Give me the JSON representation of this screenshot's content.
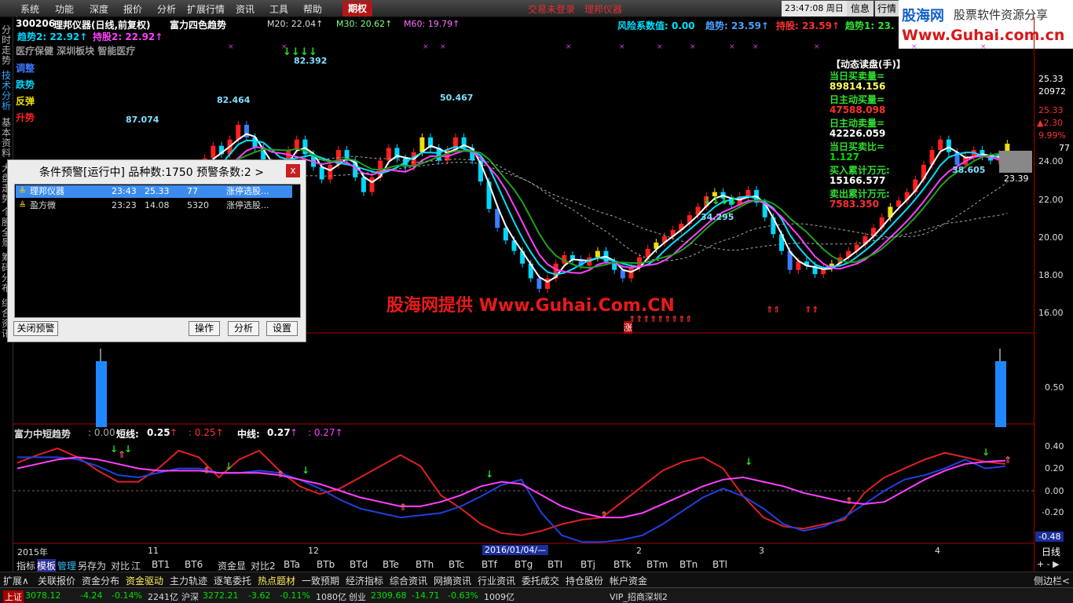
{
  "menu": {
    "items": [
      "系统",
      "功能",
      "深度",
      "报价",
      "分析",
      "扩展行情",
      "资讯",
      "工具",
      "帮助"
    ],
    "active": "期权",
    "status_red": "交易未登录　理邦仪器",
    "time": "23:47:08",
    "weekday": "周日",
    "btn_info": "信息",
    "btn_quote": "行情"
  },
  "logo": {
    "brand": "股海网",
    "slogan": "股票软件资源分享",
    "url": "Www.Guhai.com.cn"
  },
  "sidebar": {
    "tabs": [
      "分时走势",
      "技术分析",
      "基本资料",
      "大盘走势",
      "个股全景",
      "筹码分布",
      "综合资讯"
    ]
  },
  "header": {
    "code": "300206",
    "name": "理邦仪器(日线,前复权)",
    "indicator": "富力四色趋势",
    "ma20": "M20: 22.04↑",
    "ma30": "M30: 20.62↑",
    "ma60": "M60: 19.79↑",
    "risk": "风险系数值: 0.00",
    "trend_r1": "趋势: 23.59↑",
    "trend_r2": "持股: 23.59↑",
    "trend_r3": "趋势1: 23.",
    "trend2": "趋势2: 22.92↑",
    "hold2": "持股2: 22.92↑",
    "sectors": "医疗保健 深圳板块 智能医疗"
  },
  "legend": {
    "items": [
      "调整",
      "跌势",
      "反弹",
      "升势"
    ],
    "colors": [
      "#3c7cff",
      "#00d8ff",
      "#f0e000",
      "#ff2020"
    ]
  },
  "labels": {
    "p1": "87.074",
    "p2": "82.464",
    "p3": "82.392",
    "p4": "50.467",
    "p5": "34.295",
    "p6": "38.605",
    "p7": "23.39",
    "zhang": "涨"
  },
  "watermark": "股海网提供 Www.Guhai.Com.CN",
  "panel": {
    "title": "【动态读盘(手)】",
    "rows": [
      {
        "label": "当日买卖量=",
        "value": "89814.156",
        "color": "#ffff60"
      },
      {
        "label": "日主动买量=",
        "value": "47588.098",
        "color": "#ff3030"
      },
      {
        "label": "日主动卖量=",
        "value": "42226.059",
        "color": "#ffffff"
      },
      {
        "label": "当日买卖比=",
        "value": "1.127",
        "color": "#00e000"
      },
      {
        "label": "买入累计万元:",
        "value": "15166.577",
        "color": "#ffffff"
      },
      {
        "label": "卖出累计万元:",
        "value": "7583.350",
        "color": "#ff3030"
      }
    ]
  },
  "axis": {
    "price": [
      "25.33",
      "20972",
      "25.33",
      "▲2.30",
      "9.99%",
      "77",
      "24.00",
      "22.00",
      "20.00",
      "18.00",
      "16.00"
    ],
    "vol": "0.50",
    "osc": [
      "0.40",
      "0.20",
      "0.00",
      "-0.20",
      "-0.48"
    ],
    "period": "日线",
    "pm": "+  -  ▶"
  },
  "osc_header": {
    "name": "富力中短趋势",
    "v0": ": 0.00",
    "short": "短线:",
    "s1": "0.25",
    "s1a": "↑",
    "s2": ": 0.25↑",
    "mid": "中线:",
    "m1": "0.27",
    "m1a": "↑",
    "m2": ": 0.27↑"
  },
  "date_axis": [
    "2015年",
    "11",
    "12",
    "2016/01/04/—",
    "2",
    "3",
    "4"
  ],
  "popup": {
    "title": "条件预警[运行中] 品种数:1750 预警条数:2  >",
    "close": "x",
    "rows": [
      {
        "name": "理邦仪器",
        "time": "23:43",
        "price": "25.33",
        "vol": "77",
        "type": "涨停选股..."
      },
      {
        "name": "盈方微",
        "time": "23:23",
        "price": "14.08",
        "vol": "5320",
        "type": "涨停选股..."
      }
    ],
    "btn_close": "关闭预警",
    "btn_op": "操作",
    "btn_an": "分析",
    "btn_set": "设置"
  },
  "bottom_tabs": [
    "指标",
    "模板",
    "管理",
    "另存为",
    "对比",
    "江",
    "BT1",
    "BT6",
    "资金显",
    "对比2",
    "BTa",
    "BTb",
    "BTd",
    "BTe",
    "BTh",
    "BTc",
    "BTf",
    "BTg",
    "BTI",
    "BTj",
    "BTk",
    "BTm",
    "BTn",
    "BTl"
  ],
  "bottom_right": "+  -",
  "func_tabs": [
    "扩展∧",
    "关联报价",
    "资金分布",
    "资金驱动",
    "主力轨迹",
    "逐笔委托",
    "热点题材",
    "一致预期",
    "经济指标",
    "综合资讯",
    "网摘资讯",
    "行业资讯",
    "委托成交",
    "持仓股份",
    "帐户资金"
  ],
  "func_right": "侧边栏<",
  "status": {
    "sh": "上证",
    "sh_v": "3078.12",
    "sh_c": "-4.24",
    "sh_p": "-0.14%",
    "sh_a": "2241亿",
    "sz": "沪深",
    "sz_v": "3272.21",
    "sz_c": "-3.62",
    "sz_p": "-0.11%",
    "sz_a": "1080亿",
    "cy": "创业",
    "cy_v": "2309.68",
    "cy_c": "-14.71",
    "cy_p": "-0.63%",
    "cy_a": "1009亿",
    "vip": "VIP_招商深圳2"
  },
  "chart_data": {
    "type": "candlestick",
    "title": "理邦仪器(日线,前复权)",
    "ylim": [
      15.2,
      26.4
    ],
    "closes": [
      19.6,
      20.4,
      21.0,
      20.4,
      20.8,
      21.6,
      20.9,
      21.4,
      22.1,
      21.6,
      21.2,
      21.9,
      22.6,
      23.2,
      22.8,
      23.5,
      24.2,
      23.6,
      23.1,
      22.4,
      21.8,
      22.4,
      23.0,
      23.5,
      22.8,
      22.2,
      21.6,
      22.3,
      23.0,
      22.5,
      21.7,
      21.0,
      21.7,
      22.5,
      23.1,
      22.6,
      22.2,
      22.9,
      23.6,
      23.1,
      22.5,
      23.0,
      23.6,
      23.1,
      22.5,
      21.5,
      20.2,
      19.3,
      18.7,
      18.2,
      17.6,
      16.9,
      16.4,
      16.9,
      17.6,
      18.0,
      17.8,
      17.5,
      17.9,
      18.2,
      17.7,
      17.3,
      16.9,
      17.4,
      17.9,
      18.3,
      18.6,
      18.9,
      19.2,
      19.5,
      19.9,
      20.3,
      20.8,
      21.0,
      20.7,
      20.4,
      20.8,
      21.1,
      20.5,
      19.8,
      19.0,
      18.2,
      17.3,
      17.7,
      17.5,
      17.1,
      17.4,
      17.6,
      17.9,
      18.2,
      18.5,
      18.9,
      19.3,
      19.8,
      20.3,
      20.6,
      21.0,
      21.6,
      22.3,
      23.0,
      23.5,
      22.9,
      22.3,
      22.7,
      23.0,
      22.7,
      22.5,
      22.8,
      23.3
    ]
  },
  "osc_data": {
    "type": "line",
    "ylim": [
      -0.5,
      0.5
    ],
    "red": [
      0.25,
      0.32,
      0.38,
      0.3,
      0.18,
      0.08,
      0.08,
      0.2,
      0.36,
      0.3,
      0.12,
      0.28,
      0.36,
      0.18,
      0.04,
      -0.03,
      0.02,
      0.12,
      0.22,
      0.32,
      0.22,
      -0.04,
      -0.16,
      -0.3,
      -0.38,
      -0.4,
      -0.36,
      -0.3,
      -0.26,
      -0.24,
      -0.1,
      0.04,
      0.18,
      0.26,
      0.3,
      0.2,
      -0.05,
      -0.24,
      -0.32,
      -0.34,
      -0.3,
      -0.26,
      -0.02,
      0.12,
      0.2,
      0.28,
      0.34,
      0.3,
      0.26,
      0.24
    ],
    "blue": [
      0.3,
      0.3,
      0.3,
      0.28,
      0.22,
      0.14,
      0.12,
      0.16,
      0.2,
      0.2,
      0.16,
      0.16,
      0.18,
      0.16,
      0.1,
      0.02,
      -0.08,
      -0.16,
      -0.2,
      -0.24,
      -0.22,
      -0.2,
      -0.14,
      -0.05,
      0.05,
      0.1,
      -0.2,
      -0.4,
      -0.46,
      -0.46,
      -0.44,
      -0.4,
      -0.3,
      -0.18,
      -0.06,
      0.02,
      -0.05,
      -0.16,
      -0.3,
      -0.36,
      -0.32,
      -0.24,
      -0.12,
      0.0,
      0.1,
      0.14,
      0.2,
      0.28,
      0.2,
      0.22
    ],
    "magenta": [
      0.2,
      0.24,
      0.28,
      0.3,
      0.28,
      0.24,
      0.2,
      0.18,
      0.18,
      0.18,
      0.16,
      0.16,
      0.16,
      0.14,
      0.1,
      0.06,
      0.0,
      -0.06,
      -0.1,
      -0.14,
      -0.14,
      -0.1,
      -0.04,
      0.04,
      0.08,
      0.06,
      -0.04,
      -0.14,
      -0.2,
      -0.24,
      -0.24,
      -0.2,
      -0.12,
      -0.04,
      0.04,
      0.1,
      0.12,
      0.08,
      0.04,
      -0.02,
      -0.06,
      -0.1,
      -0.12,
      -0.1,
      0.0,
      0.1,
      0.18,
      0.24,
      0.26,
      0.27
    ]
  }
}
